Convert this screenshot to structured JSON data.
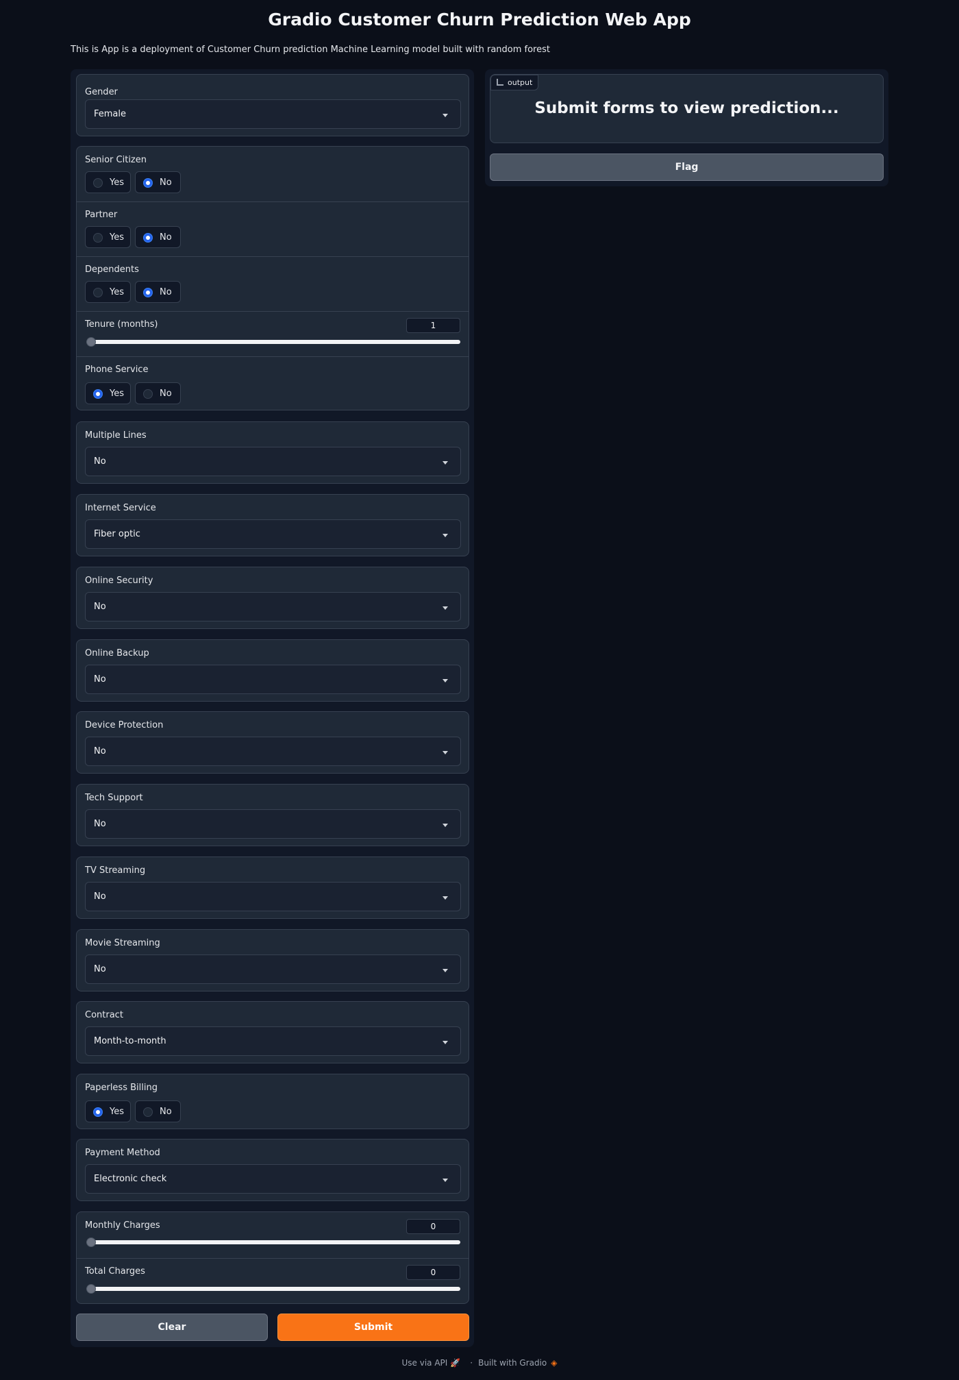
{
  "title": "Gradio Customer Churn Prediction Web App",
  "description": "This is App is a deployment of Customer Churn prediction Machine Learning model built with random forest",
  "form": {
    "gender": {
      "label": "Gender",
      "value": "Female"
    },
    "senior_citizen": {
      "label": "Senior Citizen",
      "options": [
        "Yes",
        "No"
      ],
      "selected": "No"
    },
    "partner": {
      "label": "Partner",
      "options": [
        "Yes",
        "No"
      ],
      "selected": "No"
    },
    "dependents": {
      "label": "Dependents",
      "options": [
        "Yes",
        "No"
      ],
      "selected": "No"
    },
    "tenure": {
      "label": "Tenure (months)",
      "value": "1",
      "position": 0
    },
    "phone_service": {
      "label": "Phone Service",
      "options": [
        "Yes",
        "No"
      ],
      "selected": "Yes"
    },
    "multiple_lines": {
      "label": "Multiple Lines",
      "value": "No"
    },
    "internet_service": {
      "label": "Internet Service",
      "value": "Fiber optic"
    },
    "online_security": {
      "label": "Online Security",
      "value": "No"
    },
    "online_backup": {
      "label": "Online Backup",
      "value": "No"
    },
    "device_protection": {
      "label": "Device Protection",
      "value": "No"
    },
    "tech_support": {
      "label": "Tech Support",
      "value": "No"
    },
    "tv_streaming": {
      "label": "TV Streaming",
      "value": "No"
    },
    "movie_streaming": {
      "label": "Movie Streaming",
      "value": "No"
    },
    "contract": {
      "label": "Contract",
      "value": "Month-to-month"
    },
    "paperless_billing": {
      "label": "Paperless Billing",
      "options": [
        "Yes",
        "No"
      ],
      "selected": "Yes"
    },
    "payment_method": {
      "label": "Payment Method",
      "value": "Electronic check"
    },
    "monthly_charges": {
      "label": "Monthly Charges",
      "value": "0",
      "position": 0
    },
    "total_charges": {
      "label": "Total Charges",
      "value": "0",
      "position": 0
    }
  },
  "buttons": {
    "clear": "Clear",
    "submit": "Submit",
    "flag": "Flag"
  },
  "output": {
    "tag": "output",
    "text": "Submit forms to view prediction..."
  },
  "footer": {
    "api": "Use via API",
    "separator": "·",
    "built": "Built with Gradio"
  },
  "icons": {
    "output_tag": "chart-icon",
    "api": "rocket-icon",
    "gradio": "gradio-logo-icon",
    "dropdown": "chevron-down-icon"
  },
  "colors": {
    "background": "#0b0f19",
    "panel": "#1f2937",
    "accent": "#f97316",
    "radio_checked": "#2563eb"
  }
}
